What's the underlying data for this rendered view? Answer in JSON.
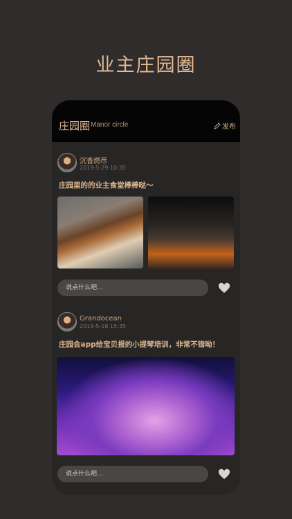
{
  "page": {
    "title": "业主庄园圈"
  },
  "header": {
    "title": "庄园圈",
    "subtitle": "Manor circle",
    "publish_label": "发布"
  },
  "posts": [
    {
      "username": "沉香燃尽",
      "date": "2019-5-29 10:35",
      "text": "庄园里的的业主食堂棒棒哒～",
      "comment_placeholder": "说点什么吧..."
    },
    {
      "username": "Grandocean",
      "date": "2019-5-18 15:35",
      "text": "庄园会app给宝贝报的小提琴培训，非常不错呦！",
      "comment_placeholder": "说点什么吧..."
    }
  ],
  "icons": {
    "publish": "pencil-icon",
    "like": "heart-icon"
  },
  "colors": {
    "accent": "#e2b994",
    "background": "#2f2c2b",
    "header": "#050505"
  }
}
